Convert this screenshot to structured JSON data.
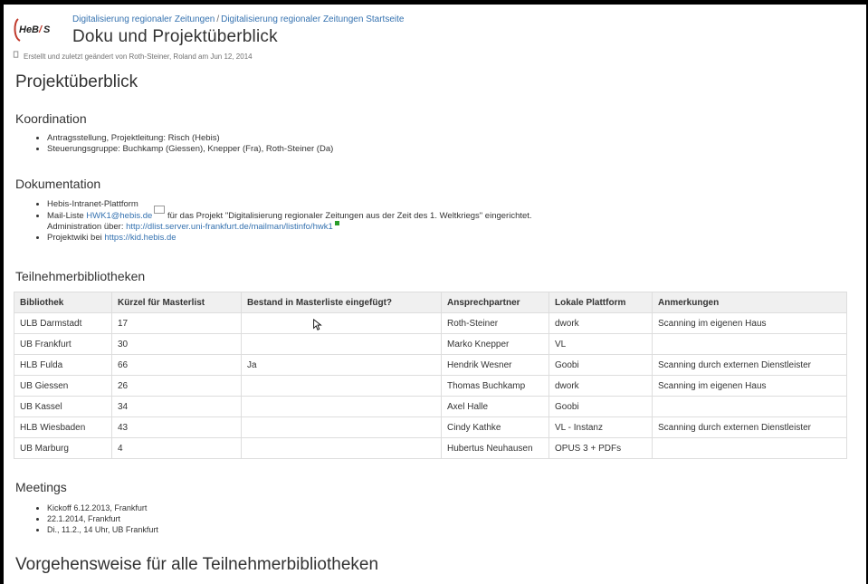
{
  "logo_text": "HeBIS",
  "breadcrumb": [
    "Digitalisierung regionaler Zeitungen",
    "Digitalisierung regionaler Zeitungen Startseite"
  ],
  "page_title": "Doku und Projektüberblick",
  "meta": "Erstellt und zuletzt geändert von Roth-Steiner, Roland am Jun 12, 2014",
  "section_title": "Projektüberblick",
  "koordination": {
    "heading": "Koordination",
    "items": [
      "Antragsstellung, Projektleitung: Risch (Hebis)",
      "Steuerungsgruppe: Buchkamp (Giessen), Knepper (Fra), Roth-Steiner (Da)"
    ]
  },
  "dokumentation": {
    "heading": "Dokumentation",
    "item1": "Hebis-Intranet-Plattform",
    "item2_prefix": "Mail-Liste ",
    "item2_link": "HWK1@hebis.de",
    "item2_suffix": " für das Projekt \"Digitalisierung regionaler Zeitungen aus der Zeit des 1. Weltkriegs\" eingerichtet.",
    "item2_admin_label": "Administration über: ",
    "item2_admin_link": "http://dlist.server.uni-frankfurt.de/mailman/listinfo/hwk1",
    "item3_prefix": "Projektwiki bei ",
    "item3_link": "https://kid.hebis.de"
  },
  "teilnehmer": {
    "heading": "Teilnehmerbibliotheken",
    "headers": [
      "Bibliothek",
      "Kürzel für Masterlist",
      "Bestand in Masterliste eingefügt?",
      "Ansprechpartner",
      "Lokale Plattform",
      "Anmerkungen"
    ],
    "rows": [
      [
        "ULB Darmstadt",
        "17",
        "",
        "Roth-Steiner",
        "dwork",
        "Scanning im eigenen Haus"
      ],
      [
        "UB Frankfurt",
        "30",
        "",
        "Marko Knepper",
        "VL",
        ""
      ],
      [
        "HLB Fulda",
        "66",
        "Ja",
        "Hendrik Wesner",
        "Goobi",
        "Scanning durch externen Dienstleister"
      ],
      [
        "UB Giessen",
        "26",
        "",
        "Thomas Buchkamp",
        "dwork",
        "Scanning im eigenen Haus"
      ],
      [
        "UB Kassel",
        "34",
        "",
        "Axel Halle",
        "Goobi",
        ""
      ],
      [
        "HLB Wiesbaden",
        "43",
        "",
        "Cindy Kathke",
        "VL - Instanz",
        "Scanning durch externen Dienstleister"
      ],
      [
        "UB Marburg",
        "4",
        "",
        "Hubertus Neuhausen",
        "OPUS 3 + PDFs",
        ""
      ]
    ]
  },
  "meetings": {
    "heading": "Meetings",
    "items": [
      "Kickoff 6.12.2013, Frankfurt",
      "22.1.2014, Frankfurt",
      "Di., 11.2., 14 Uhr, UB Frankfurt"
    ]
  },
  "vorgehensweise_heading": "Vorgehensweise für alle Teilnehmerbibliotheken"
}
